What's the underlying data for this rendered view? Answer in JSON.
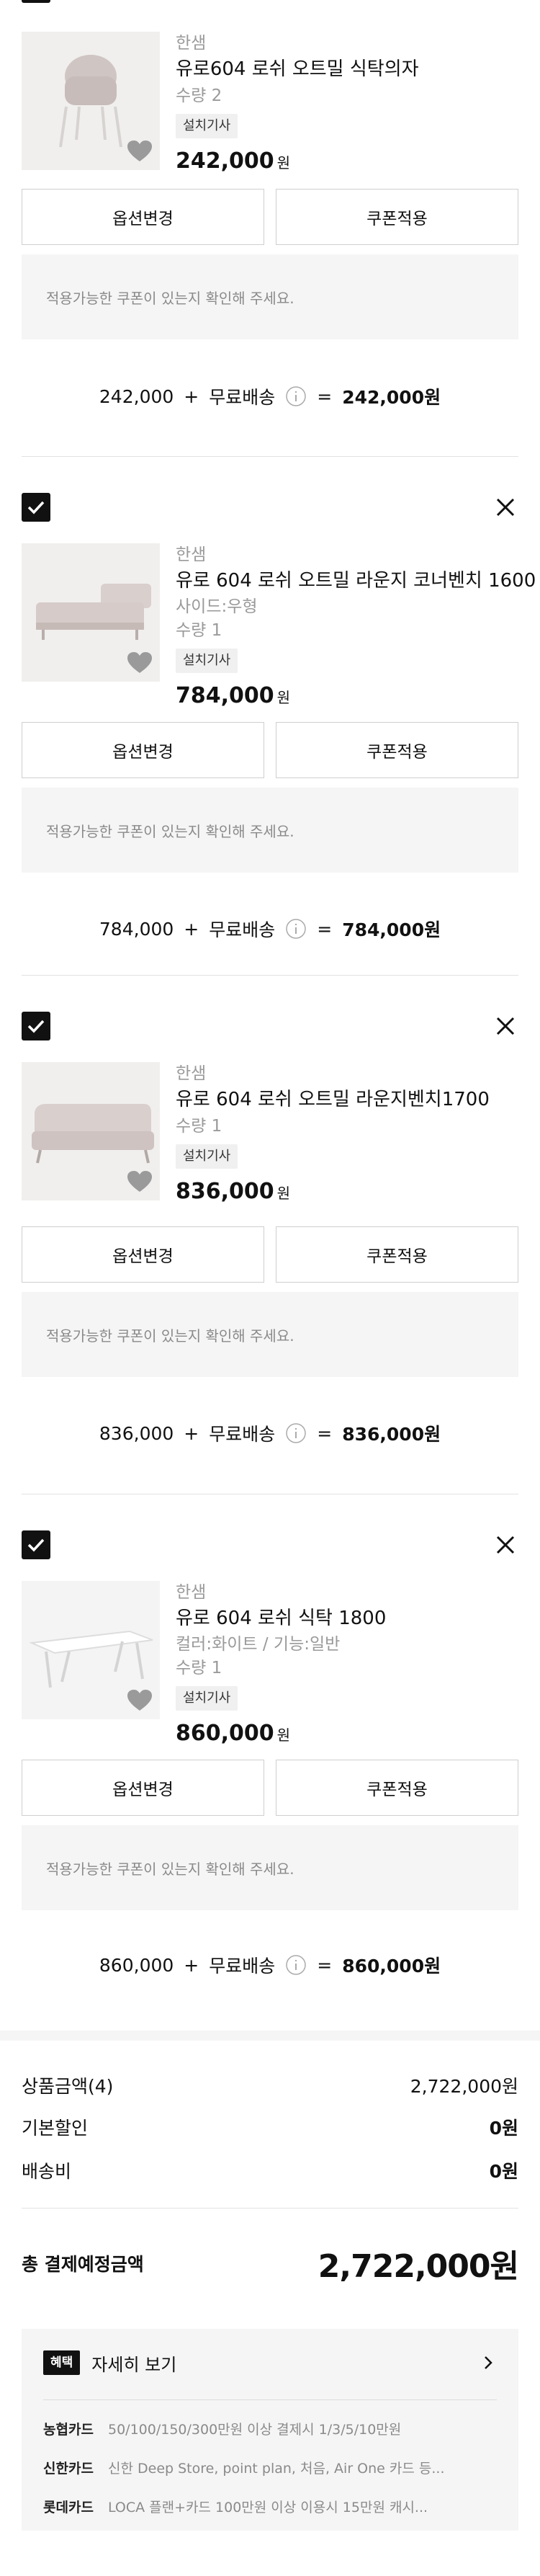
{
  "items": [
    {
      "brand": "한샘",
      "name": "유로604 로쉬 오트밀 식탁의자",
      "option": "",
      "quantity": "수량 2",
      "tag": "설치기사",
      "price": "242,000",
      "won": "원",
      "option_button": "옵션변경",
      "coupon_button": "쿠폰적용",
      "coupon_notice": "적용가능한 쿠폰이 있는지 확인해 주세요.",
      "sum_price": "242,000",
      "plus": "+",
      "shipping": "무료배송",
      "equals": "=",
      "sum_total": "242,000원",
      "image": "chair-photo"
    },
    {
      "brand": "한샘",
      "name": "유로 604 로쉬 오트밀 라운지 코너벤치 1600",
      "option": "사이드:우형",
      "quantity": "수량 1",
      "tag": "설치기사",
      "price": "784,000",
      "won": "원",
      "option_button": "옵션변경",
      "coupon_button": "쿠폰적용",
      "coupon_notice": "적용가능한 쿠폰이 있는지 확인해 주세요.",
      "sum_price": "784,000",
      "plus": "+",
      "shipping": "무료배송",
      "equals": "=",
      "sum_total": "784,000원",
      "image": "corner-bench-photo"
    },
    {
      "brand": "한샘",
      "name": "유로 604 로쉬 오트밀 라운지벤치1700",
      "option": "",
      "quantity": "수량 1",
      "tag": "설치기사",
      "price": "836,000",
      "won": "원",
      "option_button": "옵션변경",
      "coupon_button": "쿠폰적용",
      "coupon_notice": "적용가능한 쿠폰이 있는지 확인해 주세요.",
      "sum_price": "836,000",
      "plus": "+",
      "shipping": "무료배송",
      "equals": "=",
      "sum_total": "836,000원",
      "image": "lounge-bench-photo"
    },
    {
      "brand": "한샘",
      "name": "유로 604 로쉬 식탁 1800",
      "option": "컬러:화이트 / 기능:일반",
      "quantity": "수량 1",
      "tag": "설치기사",
      "price": "860,000",
      "won": "원",
      "option_button": "옵션변경",
      "coupon_button": "쿠폰적용",
      "coupon_notice": "적용가능한 쿠폰이 있는지 확인해 주세요.",
      "sum_price": "860,000",
      "plus": "+",
      "shipping": "무료배송",
      "equals": "=",
      "sum_total": "860,000원",
      "image": "table-photo"
    }
  ],
  "summary": {
    "product_label": "상품금액(4)",
    "product_value": "2,722,000원",
    "discount_label": "기본할인",
    "discount_value": "0원",
    "shipping_label": "배송비",
    "shipping_value": "0원",
    "total_label": "총 결제예정금액",
    "total_value": "2,722,000원"
  },
  "benefit": {
    "badge": "혜택",
    "title": "자세히 보기",
    "cards": [
      {
        "name": "농협카드",
        "desc": "50/100/150/300만원 이상 결제시 1/3/5/10만원"
      },
      {
        "name": "신한카드",
        "desc": "신한 Deep Store, point plan, 처음, Air One 카드 등..."
      },
      {
        "name": "롯데카드",
        "desc": "LOCA 플랜+카드 100만원 이상 이용시 15만원 캐시..."
      }
    ]
  },
  "colors": {
    "text": "#111111",
    "muted": "#9a9a9a",
    "panel": "#f5f5f5",
    "border": "#cfcfcf"
  }
}
